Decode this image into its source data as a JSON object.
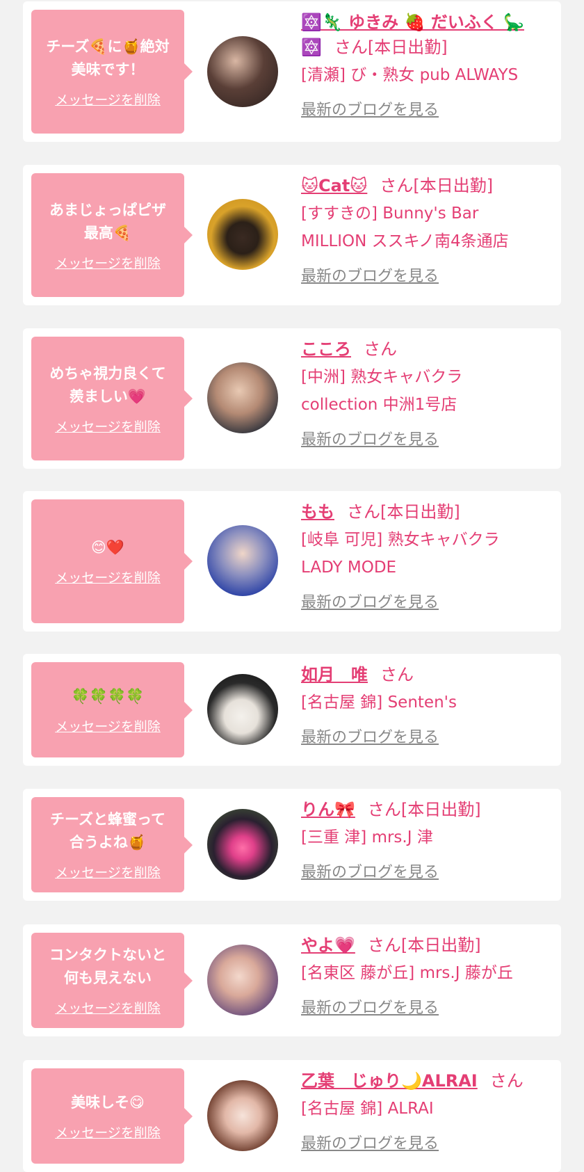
{
  "colors": {
    "background": "#f2f2f2",
    "card": "#ffffff",
    "bubble": "#f8a1b0",
    "accent": "#e43e74",
    "link_gray": "#888888"
  },
  "items": [
    {
      "message": "チーズ🍕に🍯絶対\n美味です！",
      "delete_label": "メッセージを削除",
      "name": "🔯🦎 ゆきみ 🍓 だいふく 🦕",
      "name2": "🔯",
      "suffix": "さん[本日出勤]",
      "shop": "[清瀬] び・熟女 pub ALWAYS",
      "blog_label": "最新のブログを見る"
    },
    {
      "message": "あまじょっぱピザ\n最高🍕",
      "delete_label": "メッセージを削除",
      "name": "🐱Cat🐱",
      "suffix": "さん[本日出勤]",
      "shop": "[すすきの] Bunny's Bar\nMILLION ススキノ南4条通店",
      "blog_label": "最新のブログを見る"
    },
    {
      "message": "めちゃ視力良くて\n羨ましい💗",
      "delete_label": "メッセージを削除",
      "name": "こころ",
      "suffix": "さん",
      "shop": "[中洲] 熟女キャバクラ\ncollection 中洲1号店",
      "blog_label": "最新のブログを見る"
    },
    {
      "message": "😊❤️",
      "delete_label": "メッセージを削除",
      "name": "もも",
      "suffix": "さん[本日出勤]",
      "shop": "[岐阜 可児] 熟女キャバクラ\nLADY MODE",
      "blog_label": "最新のブログを見る"
    },
    {
      "message": "🍀🍀🍀🍀",
      "delete_label": "メッセージを削除",
      "name": "如月　唯",
      "suffix": "さん",
      "shop": "[名古屋 錦] Senten's",
      "blog_label": "最新のブログを見る"
    },
    {
      "message": "チーズと蜂蜜って\n合うよね🍯",
      "delete_label": "メッセージを削除",
      "name": "りん🎀",
      "suffix": "さん[本日出勤]",
      "shop": "[三重 津] mrs.J 津",
      "blog_label": "最新のブログを見る"
    },
    {
      "message": "コンタクトないと\n何も見えない",
      "delete_label": "メッセージを削除",
      "name": "やよ💗",
      "suffix": "さん[本日出勤]",
      "shop": "[名東区 藤が丘] mrs.J 藤が丘",
      "blog_label": "最新のブログを見る"
    },
    {
      "message": "美味しそ😋",
      "delete_label": "メッセージを削除",
      "name": "乙葉　じゅり🌙ALRAI",
      "suffix": "さん",
      "shop": "[名古屋 錦] ALRAI",
      "blog_label": "最新のブログを見る"
    }
  ]
}
